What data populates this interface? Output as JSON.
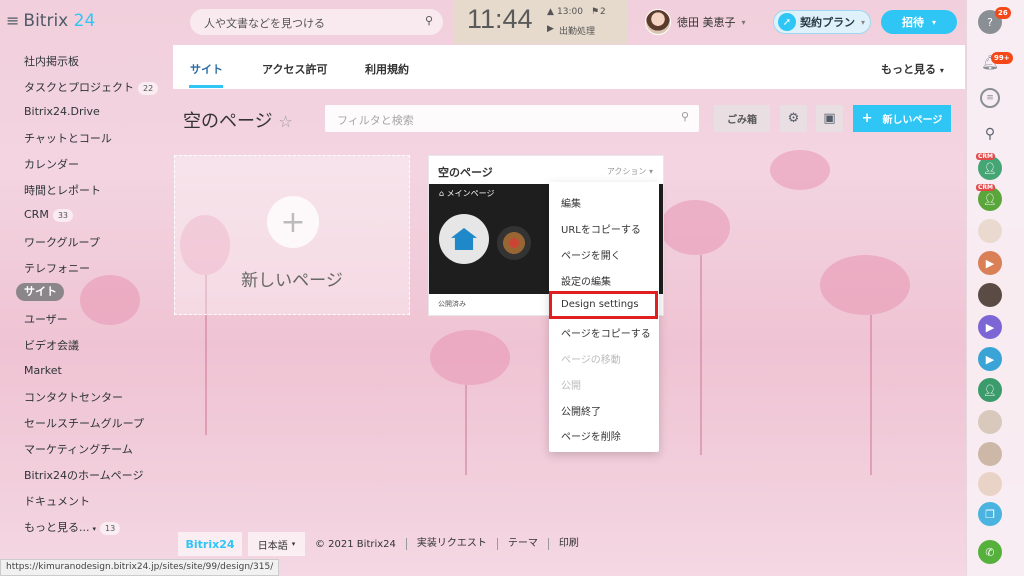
{
  "header": {
    "logo_main": "Bitrix",
    "logo_num": "24",
    "search_placeholder": "人や文書などを見つける",
    "clock_time": "11:44",
    "clock_alarm": "13:00",
    "clock_flags": "2",
    "clock_status": "出勤処理",
    "user_name": "徳田 美恵子",
    "plan_label": "契約プラン",
    "invite_label": "招待"
  },
  "sidebar": {
    "items": [
      {
        "label": "社内掲示板"
      },
      {
        "label": "タスクとプロジェクト",
        "count": "22"
      },
      {
        "label": "Bitrix24.Drive"
      },
      {
        "label": "チャットとコール"
      },
      {
        "label": "カレンダー"
      },
      {
        "label": "時間とレポート"
      },
      {
        "label": "CRM",
        "count": "33"
      },
      {
        "label": "ワークグループ"
      },
      {
        "label": "テレフォニー"
      },
      {
        "label": "サイト"
      },
      {
        "label": "ユーザー"
      },
      {
        "label": "ビデオ会議"
      },
      {
        "label": "Market"
      },
      {
        "label": "コンタクトセンター"
      },
      {
        "label": "セールスチームグループ"
      },
      {
        "label": "マーケティングチーム"
      },
      {
        "label": "Bitrix24のホームページ"
      },
      {
        "label": "ドキュメント"
      },
      {
        "label": "もっと見る...",
        "count": "13"
      }
    ]
  },
  "tabs": [
    {
      "label": "サイト"
    },
    {
      "label": "アクセス許可"
    },
    {
      "label": "利用規約"
    }
  ],
  "tabs_more": "もっと見る",
  "page": {
    "title": "空のページ",
    "filter_placeholder": "フィルタと検索",
    "trash_label": "ごみ箱",
    "new_page_label": "新しいページ"
  },
  "tiles": {
    "new_label": "新しいページ",
    "page_title": "空のページ",
    "actions_label": "アクション",
    "preview_label": "メインページ",
    "status": "公開済み"
  },
  "context_menu": {
    "items": [
      {
        "label": "編集",
        "disabled": false
      },
      {
        "label": "URLをコピーする",
        "disabled": false
      },
      {
        "label": "ページを開く",
        "disabled": false
      },
      {
        "label": "設定の編集",
        "disabled": false
      },
      {
        "label": "Design settings",
        "disabled": false
      },
      {
        "label": "ページをコピーする",
        "disabled": false
      },
      {
        "label": "ページの移動",
        "disabled": true
      },
      {
        "label": "公開",
        "disabled": true
      },
      {
        "label": "公開終了",
        "disabled": false
      },
      {
        "label": "ページを削除",
        "disabled": false
      }
    ]
  },
  "footer": {
    "logo": "Bitrix24",
    "language": "日本語",
    "copyright": "© 2021 Bitrix24",
    "links": [
      "実装リクエスト",
      "テーマ",
      "印刷"
    ]
  },
  "statusbar_url": "https://kimuranodesign.bitrix24.jp/sites/site/99/design/315/",
  "rightbar": {
    "help_badge": "26",
    "notify_badge": "99+",
    "crm_tag": "CRM"
  },
  "colors": {
    "accent": "#2fc6f6",
    "highlight": "#e02020",
    "active_tab": "#2b6ea5"
  }
}
